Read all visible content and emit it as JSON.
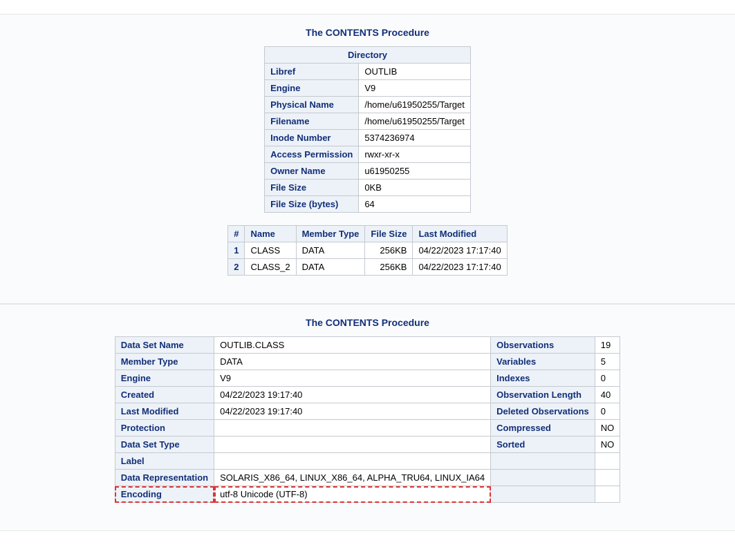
{
  "section1": {
    "title": "The CONTENTS Procedure",
    "directory": {
      "caption": "Directory",
      "rows": [
        {
          "label": "Libref",
          "value": "OUTLIB"
        },
        {
          "label": "Engine",
          "value": "V9"
        },
        {
          "label": "Physical Name",
          "value": "/home/u61950255/Target"
        },
        {
          "label": "Filename",
          "value": "/home/u61950255/Target"
        },
        {
          "label": "Inode Number",
          "value": "5374236974"
        },
        {
          "label": "Access Permission",
          "value": "rwxr-xr-x"
        },
        {
          "label": "Owner Name",
          "value": "u61950255"
        },
        {
          "label": "File Size",
          "value": "0KB"
        },
        {
          "label": "File Size (bytes)",
          "value": "64"
        }
      ]
    },
    "members": {
      "headers": [
        "#",
        "Name",
        "Member Type",
        "File Size",
        "Last Modified"
      ],
      "rows": [
        {
          "n": "1",
          "name": "CLASS",
          "type": "DATA",
          "size": "256KB",
          "modified": "04/22/2023 17:17:40"
        },
        {
          "n": "2",
          "name": "CLASS_2",
          "type": "DATA",
          "size": "256KB",
          "modified": "04/22/2023 17:17:40"
        }
      ]
    }
  },
  "section2": {
    "title": "The CONTENTS Procedure",
    "attrs": {
      "rows": [
        {
          "l1": "Data Set Name",
          "v1": "OUTLIB.CLASS",
          "l2": "Observations",
          "v2": "19"
        },
        {
          "l1": "Member Type",
          "v1": "DATA",
          "l2": "Variables",
          "v2": "5"
        },
        {
          "l1": "Engine",
          "v1": "V9",
          "l2": "Indexes",
          "v2": "0"
        },
        {
          "l1": "Created",
          "v1": "04/22/2023 19:17:40",
          "l2": "Observation Length",
          "v2": "40"
        },
        {
          "l1": "Last Modified",
          "v1": "04/22/2023 19:17:40",
          "l2": "Deleted Observations",
          "v2": "0"
        },
        {
          "l1": "Protection",
          "v1": "",
          "l2": "Compressed",
          "v2": "NO"
        },
        {
          "l1": "Data Set Type",
          "v1": "",
          "l2": "Sorted",
          "v2": "NO"
        },
        {
          "l1": "Label",
          "v1": "",
          "l2": "",
          "v2": ""
        },
        {
          "l1": "Data Representation",
          "v1": "SOLARIS_X86_64, LINUX_X86_64, ALPHA_TRU64, LINUX_IA64",
          "l2": "",
          "v2": ""
        },
        {
          "l1": "Encoding",
          "v1": "utf-8 Unicode (UTF-8)",
          "l2": "",
          "v2": "",
          "hl": true
        }
      ]
    }
  }
}
